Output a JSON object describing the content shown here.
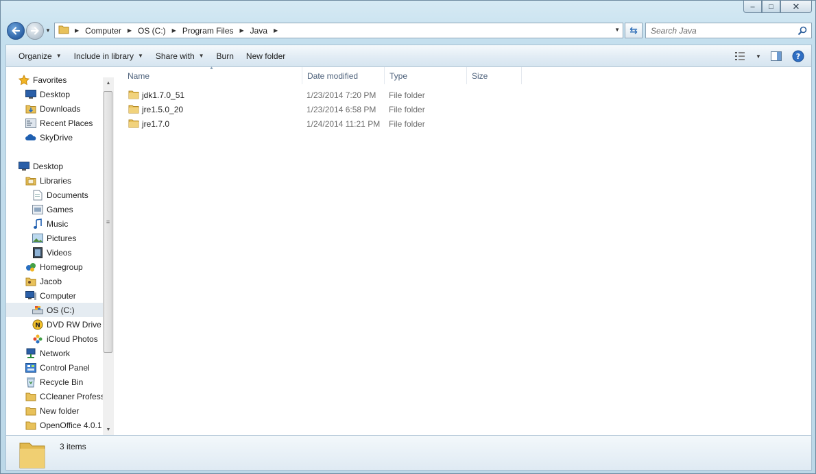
{
  "window": {
    "controls": {
      "minimize": "–",
      "maximize": "□",
      "close": "✕"
    }
  },
  "address": {
    "breadcrumbs": [
      "Computer",
      "OS (C:)",
      "Program Files",
      "Java"
    ],
    "search_placeholder": "Search Java"
  },
  "toolbar": {
    "organize": "Organize",
    "include_in_library": "Include in library",
    "share_with": "Share with",
    "burn": "Burn",
    "new_folder": "New folder"
  },
  "navigation": {
    "favorites": [
      {
        "label": "Favorites",
        "icon": "star-icon"
      },
      {
        "label": "Desktop",
        "icon": "desktop-icon"
      },
      {
        "label": "Downloads",
        "icon": "downloads-icon"
      },
      {
        "label": "Recent Places",
        "icon": "recent-places-icon"
      },
      {
        "label": "SkyDrive",
        "icon": "skydrive-icon"
      }
    ],
    "tree": [
      {
        "label": "Desktop",
        "icon": "desktop-icon"
      },
      {
        "label": "Libraries",
        "icon": "libraries-icon"
      },
      {
        "label": "Documents",
        "icon": "documents-icon"
      },
      {
        "label": "Games",
        "icon": "games-icon"
      },
      {
        "label": "Music",
        "icon": "music-icon"
      },
      {
        "label": "Pictures",
        "icon": "pictures-icon"
      },
      {
        "label": "Videos",
        "icon": "videos-icon"
      },
      {
        "label": "Homegroup",
        "icon": "homegroup-icon"
      },
      {
        "label": "Jacob",
        "icon": "user-folder-icon"
      },
      {
        "label": "Computer",
        "icon": "computer-icon"
      },
      {
        "label": "OS (C:)",
        "icon": "drive-icon"
      },
      {
        "label": "DVD RW Drive (",
        "icon": "dvd-drive-icon"
      },
      {
        "label": "iCloud Photos",
        "icon": "icloud-photos-icon"
      },
      {
        "label": "Network",
        "icon": "network-icon"
      },
      {
        "label": "Control Panel",
        "icon": "control-panel-icon"
      },
      {
        "label": "Recycle Bin",
        "icon": "recycle-bin-icon"
      },
      {
        "label": "CCleaner Profess",
        "icon": "folder-icon"
      },
      {
        "label": "New folder",
        "icon": "folder-icon"
      },
      {
        "label": "OpenOffice 4.0.1",
        "icon": "folder-icon"
      }
    ],
    "selected": "OS (C:)"
  },
  "columns": {
    "name": "Name",
    "date_modified": "Date modified",
    "type": "Type",
    "size": "Size"
  },
  "files": [
    {
      "name": "jdk1.7.0_51",
      "date": "1/23/2014 7:20 PM",
      "type": "File folder",
      "size": ""
    },
    {
      "name": "jre1.5.0_20",
      "date": "1/23/2014 6:58 PM",
      "type": "File folder",
      "size": ""
    },
    {
      "name": "jre1.7.0",
      "date": "1/24/2014 11:21 PM",
      "type": "File folder",
      "size": ""
    }
  ],
  "details": {
    "item_count": "3 items"
  },
  "colors": {
    "frame": "#c4dfee",
    "selection": "#e5ecf2",
    "header_text": "#4c607a",
    "folder": "#e8c15a"
  }
}
